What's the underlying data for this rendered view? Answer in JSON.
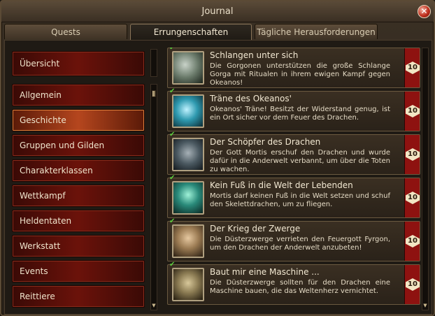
{
  "window": {
    "title": "Journal"
  },
  "tabs": [
    {
      "label": "Quests"
    },
    {
      "label": "Errungenschaften",
      "active": true
    },
    {
      "label": "Tägliche Herausforderungen"
    }
  ],
  "nav": {
    "overview": "Übersicht",
    "items": [
      {
        "label": "Allgemein"
      },
      {
        "label": "Geschichte",
        "selected": true
      },
      {
        "label": "Gruppen und Gilden"
      },
      {
        "label": "Charakterklassen"
      },
      {
        "label": "Wettkampf"
      },
      {
        "label": "Heldentaten"
      },
      {
        "label": "Werkstatt"
      },
      {
        "label": "Events"
      },
      {
        "label": "Reittiere"
      }
    ]
  },
  "achievements": [
    {
      "title": "Schlangen unter sich",
      "desc": "Die Gorgonen unterstützen die große Schlange Gorga mit Ritualen in ihrem ewigen Kampf gegen Okeanos!",
      "points": "10",
      "icon": "serpent-icon",
      "icon_color": "#7a8a7a"
    },
    {
      "title": "Träne des Okeanos'",
      "desc": "Okeanos' Träne! Besitzt der Widerstand genug, ist ein Ort sicher vor dem Feuer des Drachen.",
      "points": "10",
      "icon": "teardrop-icon",
      "icon_color": "#3aa6b8"
    },
    {
      "title": "Der Schöpfer des Drachen",
      "desc": "Der Gott Mortis erschuf den Drachen und wurde dafür in die Anderwelt verbannt, um über die Toten zu wachen.",
      "points": "10",
      "icon": "mortis-icon",
      "icon_color": "#5a6a72"
    },
    {
      "title": "Kein Fuß in die Welt der Lebenden",
      "desc": "Mortis darf keinen Fuß in die Welt setzen und schuf den Skelettdrachen, um zu fliegen.",
      "points": "10",
      "icon": "spirit-icon",
      "icon_color": "#2a8a7a"
    },
    {
      "title": "Der Krieg der Zwerge",
      "desc": "Die Düsterzwerge verrieten den Feuergott Fyrgon, um den Drachen der Anderwelt anzubeten!",
      "points": "10",
      "icon": "dwarf-icon",
      "icon_color": "#a08a6a"
    },
    {
      "title": "Baut mir eine Maschine ...",
      "desc": "Die Düsterzwerge sollten für den Drachen eine Maschine bauen, die das Weltenherz vernichtet.",
      "points": "10",
      "icon": "machine-icon",
      "icon_color": "#8a7a5a"
    }
  ]
}
